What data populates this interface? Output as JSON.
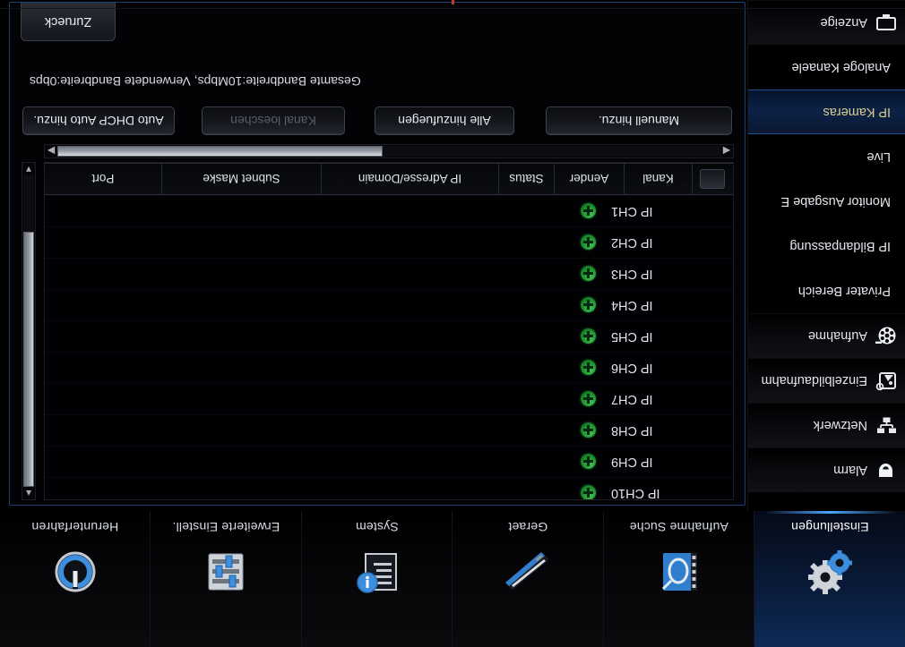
{
  "window": {
    "title": "IP Kameras",
    "accent_color": "#1f4f96",
    "selected_text_color": "#d9cf8a"
  },
  "panel": {
    "tab_label": "Zurueck",
    "bandwidth_info": "Gesamte Bandbreite:10Mbps, Verwendete Bandbreite:0bps"
  },
  "buttons": [
    {
      "label": "Manuell hinzu.",
      "disabled": false,
      "name": "manual-add-button"
    },
    {
      "label": "Alle hinzufuegen",
      "disabled": false,
      "name": "add-all-button"
    },
    {
      "label": "Kanal loeschen",
      "disabled": true,
      "name": "delete-channel-button"
    },
    {
      "label": "Auto DHCP Auto hinzu.",
      "disabled": false,
      "name": "auto-dhcp-add-button"
    }
  ],
  "table": {
    "columns": [
      "Kanal",
      "Aender",
      "Status",
      "IP Adresse/Domain",
      "Subnet Maske",
      "Port"
    ],
    "rows": [
      {
        "channel": "IP CH1",
        "action": "add",
        "status": "",
        "ip": "",
        "subnet": "",
        "port": ""
      },
      {
        "channel": "IP CH2",
        "action": "add",
        "status": "",
        "ip": "",
        "subnet": "",
        "port": ""
      },
      {
        "channel": "IP CH3",
        "action": "add",
        "status": "",
        "ip": "",
        "subnet": "",
        "port": ""
      },
      {
        "channel": "IP CH4",
        "action": "add",
        "status": "",
        "ip": "",
        "subnet": "",
        "port": ""
      },
      {
        "channel": "IP CH5",
        "action": "add",
        "status": "",
        "ip": "",
        "subnet": "",
        "port": ""
      },
      {
        "channel": "IP CH6",
        "action": "add",
        "status": "",
        "ip": "",
        "subnet": "",
        "port": ""
      },
      {
        "channel": "IP CH7",
        "action": "add",
        "status": "",
        "ip": "",
        "subnet": "",
        "port": ""
      },
      {
        "channel": "IP CH8",
        "action": "add",
        "status": "",
        "ip": "",
        "subnet": "",
        "port": ""
      },
      {
        "channel": "IP CH9",
        "action": "add",
        "status": "",
        "ip": "",
        "subnet": "",
        "port": ""
      },
      {
        "channel": "IP CH10",
        "action": "add",
        "status": "",
        "ip": "",
        "subnet": "",
        "port": ""
      }
    ]
  },
  "sidebar": {
    "items": [
      {
        "label": "Anzeige",
        "icon": "monitor-icon",
        "selected": false,
        "style": "panel"
      },
      {
        "label": "Analoge Kanaele",
        "icon": "none",
        "selected": false,
        "style": "plain"
      },
      {
        "label": "IP Kameras",
        "icon": "none",
        "selected": true,
        "style": "plain"
      },
      {
        "label": "Live",
        "icon": "none",
        "selected": false,
        "style": "plain"
      },
      {
        "label": "Monitor Ausgabe E",
        "icon": "none",
        "selected": false,
        "style": "plain"
      },
      {
        "label": "IP Bildanpassung",
        "icon": "none",
        "selected": false,
        "style": "plain"
      },
      {
        "label": "Privater Bereich",
        "icon": "none",
        "selected": false,
        "style": "plain"
      },
      {
        "label": "Aufnahme",
        "icon": "film-reel-icon",
        "selected": false,
        "style": "panel"
      },
      {
        "label": "Einzelbildaufnahm",
        "icon": "snapshot-icon",
        "selected": false,
        "style": "panel"
      },
      {
        "label": "Netzwerk",
        "icon": "network-icon",
        "selected": false,
        "style": "panel"
      },
      {
        "label": "Alarm",
        "icon": "alarm-icon",
        "selected": false,
        "style": "panel"
      }
    ]
  },
  "mainnav": {
    "items": [
      {
        "label": "Einstellungen",
        "icon": "gears-icon",
        "active": true
      },
      {
        "label": "Aufnahme Suche",
        "icon": "filmsearch-icon",
        "active": false
      },
      {
        "label": "Geraet",
        "icon": "harddisk-icon",
        "active": false
      },
      {
        "label": "System",
        "icon": "sysinfo-icon",
        "active": false
      },
      {
        "label": "Erweiterte Einstell.",
        "icon": "sliders-icon",
        "active": false
      },
      {
        "label": "Herunterfahren",
        "icon": "power-icon",
        "active": false
      }
    ]
  }
}
